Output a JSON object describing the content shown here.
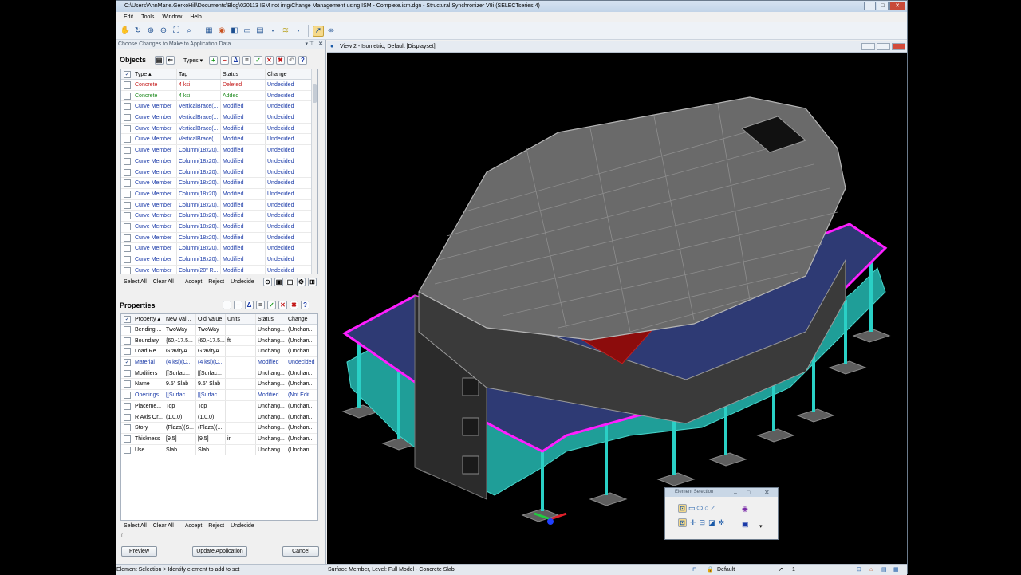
{
  "window": {
    "title": "C:\\Users\\AnnMarie.GerkoHill\\Documents\\Blog\\020113  ISM not intg\\Change Management using ISM - Complete.ism.dgn - Structural Synchronizer V8i (SELECTseries 4)",
    "controls": [
      "–",
      "□",
      "✕"
    ]
  },
  "menu": [
    "Edit",
    "Tools",
    "Window",
    "Help"
  ],
  "panel": {
    "header": "Choose Changes to Make to Application Data",
    "objects_title": "Objects",
    "types_label": "Types",
    "objects_columns": [
      "Type",
      "Tag",
      "Status",
      "Change"
    ],
    "objects_rows": [
      {
        "type": "Concrete",
        "tag": "4 ksi",
        "status": "Deleted",
        "change": "Undecided",
        "tone": "red"
      },
      {
        "type": "Concrete",
        "tag": "4 ksi",
        "status": "Added",
        "change": "Undecided",
        "tone": "green"
      },
      {
        "type": "Curve Member",
        "tag": "VerticalBrace(...",
        "status": "Modified",
        "change": "Undecided",
        "tone": "blue"
      },
      {
        "type": "Curve Member",
        "tag": "VerticalBrace(...",
        "status": "Modified",
        "change": "Undecided",
        "tone": "blue"
      },
      {
        "type": "Curve Member",
        "tag": "VerticalBrace(...",
        "status": "Modified",
        "change": "Undecided",
        "tone": "blue"
      },
      {
        "type": "Curve Member",
        "tag": "VerticalBrace(...",
        "status": "Modified",
        "change": "Undecided",
        "tone": "blue"
      },
      {
        "type": "Curve Member",
        "tag": "Column(18x20)...",
        "status": "Modified",
        "change": "Undecided",
        "tone": "blue"
      },
      {
        "type": "Curve Member",
        "tag": "Column(18x20)...",
        "status": "Modified",
        "change": "Undecided",
        "tone": "blue"
      },
      {
        "type": "Curve Member",
        "tag": "Column(18x20)...",
        "status": "Modified",
        "change": "Undecided",
        "tone": "blue"
      },
      {
        "type": "Curve Member",
        "tag": "Column(18x20)...",
        "status": "Modified",
        "change": "Undecided",
        "tone": "blue"
      },
      {
        "type": "Curve Member",
        "tag": "Column(18x20)...",
        "status": "Modified",
        "change": "Undecided",
        "tone": "blue"
      },
      {
        "type": "Curve Member",
        "tag": "Column(18x20)...",
        "status": "Modified",
        "change": "Undecided",
        "tone": "blue"
      },
      {
        "type": "Curve Member",
        "tag": "Column(18x20)...",
        "status": "Modified",
        "change": "Undecided",
        "tone": "blue"
      },
      {
        "type": "Curve Member",
        "tag": "Column(18x20)...",
        "status": "Modified",
        "change": "Undecided",
        "tone": "blue"
      },
      {
        "type": "Curve Member",
        "tag": "Column(18x20)...",
        "status": "Modified",
        "change": "Undecided",
        "tone": "blue"
      },
      {
        "type": "Curve Member",
        "tag": "Column(18x20)...",
        "status": "Modified",
        "change": "Undecided",
        "tone": "blue"
      },
      {
        "type": "Curve Member",
        "tag": "Column(18x20)...",
        "status": "Modified",
        "change": "Undecided",
        "tone": "blue"
      },
      {
        "type": "Curve Member",
        "tag": "Column(20\" R...",
        "status": "Modified",
        "change": "Undecided",
        "tone": "blue"
      }
    ],
    "actions": [
      "Select All",
      "Clear All",
      "Accept",
      "Reject",
      "Undecide"
    ],
    "properties_title": "Properties",
    "properties_columns": [
      "Property",
      "New Val...",
      "Old Value",
      "Units",
      "Status",
      "Change"
    ],
    "properties_rows": [
      {
        "checked": false,
        "property": "Bending ...",
        "new": "TwoWay",
        "old": "TwoWay",
        "units": "",
        "status": "Unchang...",
        "change": "(Unchan...",
        "tone": ""
      },
      {
        "checked": false,
        "property": "Boundary",
        "new": "{60,-17.5...",
        "old": "{60,-17.5...",
        "units": "ft",
        "status": "Unchang...",
        "change": "(Unchan...",
        "tone": ""
      },
      {
        "checked": false,
        "property": "Load Re...",
        "new": "GravityA...",
        "old": "GravityA...",
        "units": "",
        "status": "Unchang...",
        "change": "(Unchan...",
        "tone": ""
      },
      {
        "checked": true,
        "property": "Material",
        "new": "(4 ksi)(C...",
        "old": "(4 ksi)(C...",
        "units": "",
        "status": "Modified",
        "change": "Undecided",
        "tone": "blue"
      },
      {
        "checked": false,
        "property": "Modifiers",
        "new": "[[Surfac...",
        "old": "[[Surfac...",
        "units": "",
        "status": "Unchang...",
        "change": "(Unchan...",
        "tone": ""
      },
      {
        "checked": false,
        "property": "Name",
        "new": "9.5\" Slab",
        "old": "9.5\" Slab",
        "units": "",
        "status": "Unchang...",
        "change": "(Unchan...",
        "tone": ""
      },
      {
        "checked": false,
        "property": "Openings",
        "new": "[[Surfac...",
        "old": "[[Surfac...",
        "units": "",
        "status": "Modified",
        "change": "(Not Edit...",
        "tone": "blue"
      },
      {
        "checked": false,
        "property": "Placeme...",
        "new": "Top",
        "old": "Top",
        "units": "",
        "status": "Unchang...",
        "change": "(Unchan...",
        "tone": ""
      },
      {
        "checked": false,
        "property": "R Axis Or...",
        "new": "(1,0,0)",
        "old": "(1,0,0)",
        "units": "",
        "status": "Unchang...",
        "change": "(Unchan...",
        "tone": ""
      },
      {
        "checked": false,
        "property": "Story",
        "new": "(Plaza)(S...",
        "old": "(Plaza)(...",
        "units": "",
        "status": "Unchang...",
        "change": "(Unchan...",
        "tone": ""
      },
      {
        "checked": false,
        "property": "Thickness",
        "new": "[9.5]",
        "old": "[9.5]",
        "units": "in",
        "status": "Unchang...",
        "change": "(Unchan...",
        "tone": ""
      },
      {
        "checked": false,
        "property": "Use",
        "new": "Slab",
        "old": "Slab",
        "units": "",
        "status": "Unchang...",
        "change": "(Unchan...",
        "tone": ""
      }
    ],
    "footer_note": "f",
    "preview_label": "Preview",
    "update_label": "Update Application",
    "cancel_label": "Cancel"
  },
  "view": {
    "title": "View 2 - Isometric, Default [Displayset]"
  },
  "status": {
    "prompt": "Element Selection > Identify element to add to set",
    "message": "Surface Member, Level: Full Model - Concrete Slab",
    "level": "Default",
    "count": "1"
  },
  "element_selection": {
    "title": "Element Selection"
  },
  "colors": {
    "teal": "#1fb3a8",
    "magenta": "#ff1eff",
    "slab_blue": "#33407a",
    "roof_gray": "#6a6a6a",
    "red_panel": "#8c0c0c"
  }
}
